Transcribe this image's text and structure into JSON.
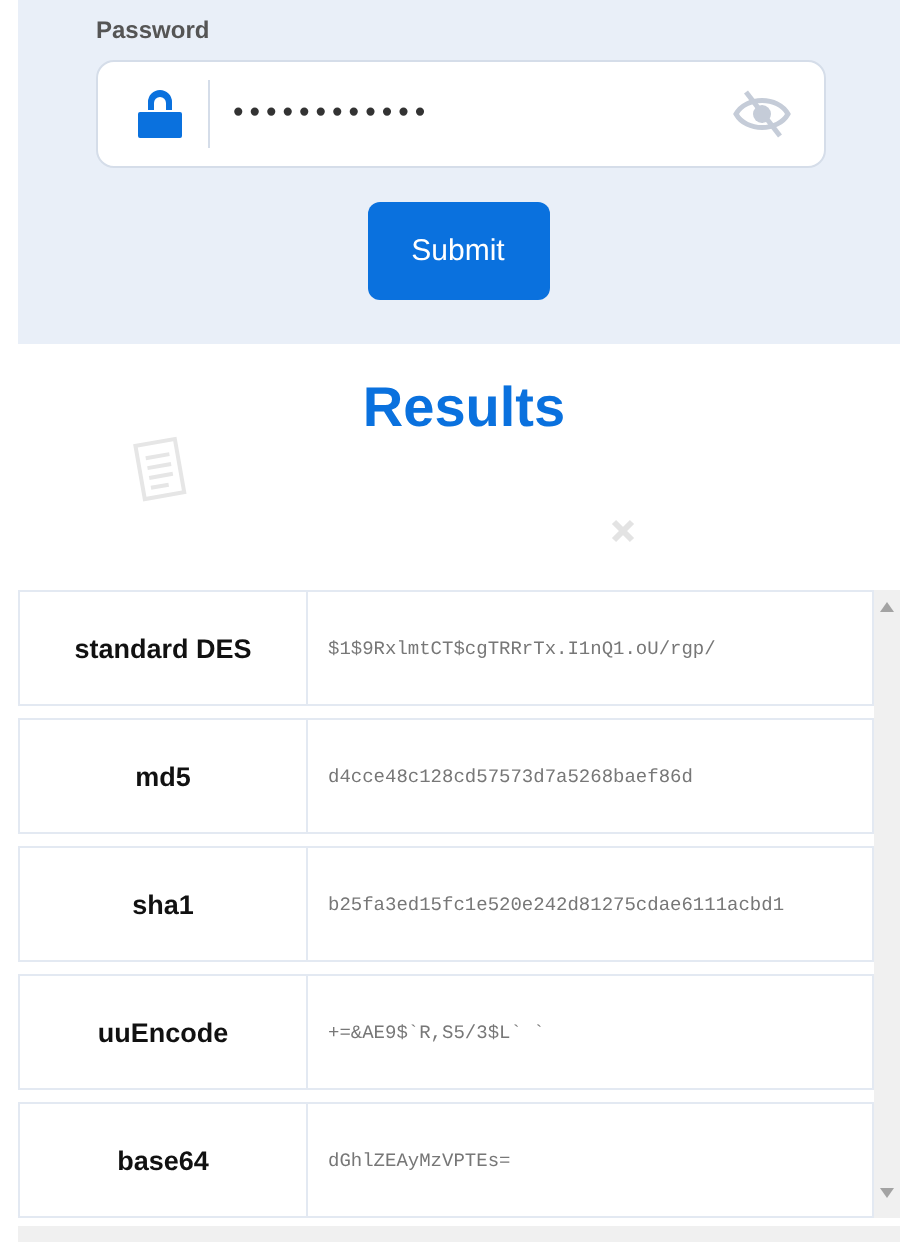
{
  "password_form": {
    "label": "Password",
    "value": "••••••••••••",
    "submit": "Submit"
  },
  "results": {
    "title": "Results"
  },
  "table": {
    "rows": [
      {
        "algorithm": "standard DES",
        "hash": "$1$9RxlmtCT$cgTRRrTx.I1nQ1.oU/rgp/"
      },
      {
        "algorithm": "md5",
        "hash": "d4cce48c128cd57573d7a5268baef86d"
      },
      {
        "algorithm": "sha1",
        "hash": "b25fa3ed15fc1e520e242d81275cdae6111acbd1"
      },
      {
        "algorithm": "uuEncode",
        "hash": "+=&AE9$`R,S5/3$L` `"
      },
      {
        "algorithm": "base64",
        "hash": "dGhlZEAyMzVPTEs="
      }
    ]
  }
}
